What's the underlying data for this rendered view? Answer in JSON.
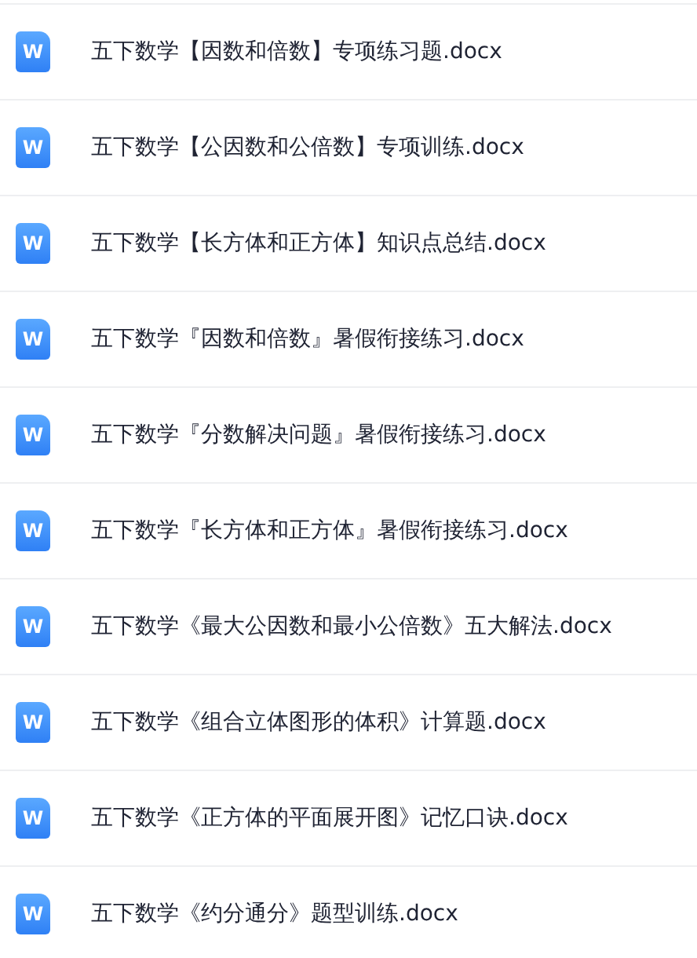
{
  "files": [
    {
      "icon_text": "W",
      "name": "五下数学【因数和倍数】专项练习题.docx"
    },
    {
      "icon_text": "W",
      "name": "五下数学【公因数和公倍数】专项训练.docx"
    },
    {
      "icon_text": "W",
      "name": "五下数学【长方体和正方体】知识点总结.docx"
    },
    {
      "icon_text": "W",
      "name": "五下数学『因数和倍数』暑假衔接练习.docx"
    },
    {
      "icon_text": "W",
      "name": "五下数学『分数解决问题』暑假衔接练习.docx"
    },
    {
      "icon_text": "W",
      "name": "五下数学『长方体和正方体』暑假衔接练习.docx"
    },
    {
      "icon_text": "W",
      "name": "五下数学《最大公因数和最小公倍数》五大解法.docx"
    },
    {
      "icon_text": "W",
      "name": "五下数学《组合立体图形的体积》计算题.docx"
    },
    {
      "icon_text": "W",
      "name": "五下数学《正方体的平面展开图》记忆口诀.docx"
    },
    {
      "icon_text": "W",
      "name": "五下数学《约分通分》题型训练.docx"
    }
  ]
}
